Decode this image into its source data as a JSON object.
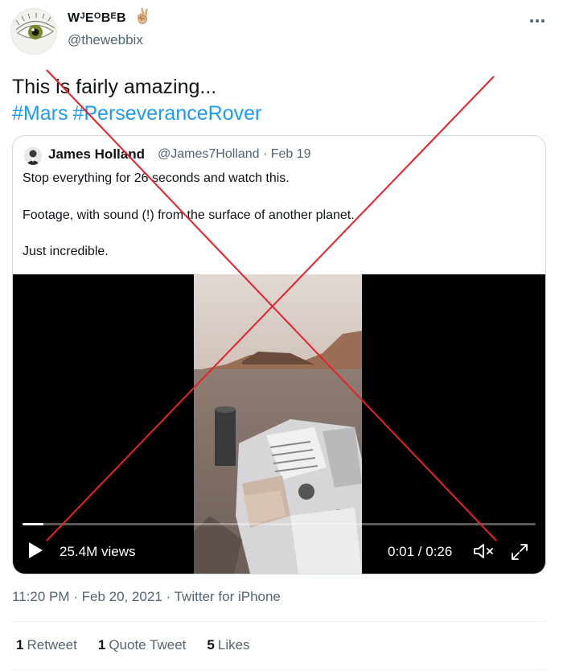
{
  "author": {
    "name": "WᴶEᴼBᴱB",
    "emoji": "✌🏼",
    "handle": "@thewebbix"
  },
  "tweet": {
    "text": "This is fairly amazing...",
    "hashtags": [
      "#Mars",
      "#PerseveranceRover"
    ]
  },
  "quoted": {
    "name": "James Holland",
    "handle": "@James7Holland",
    "date": "Feb 19",
    "meta": "@James7Holland · Feb 19",
    "lines": [
      "Stop everything for 26 seconds and watch this.",
      "Footage, with sound (!) from the surface of another planet.",
      "Just incredible."
    ],
    "video": {
      "views": "25.4M views",
      "time": "0:01 / 0:26",
      "progress": 0.04
    }
  },
  "meta": "11:20 PM · Feb 20, 2021 · Twitter for iPhone",
  "stats": {
    "retweets": {
      "count": "1",
      "label": "Retweet"
    },
    "quotes": {
      "count": "1",
      "label": "Quote Tweet"
    },
    "likes": {
      "count": "5",
      "label": "Likes"
    }
  },
  "colors": {
    "link": "#1d9bf0",
    "secondary": "#536471",
    "overlay_cross": "#e8202a"
  }
}
